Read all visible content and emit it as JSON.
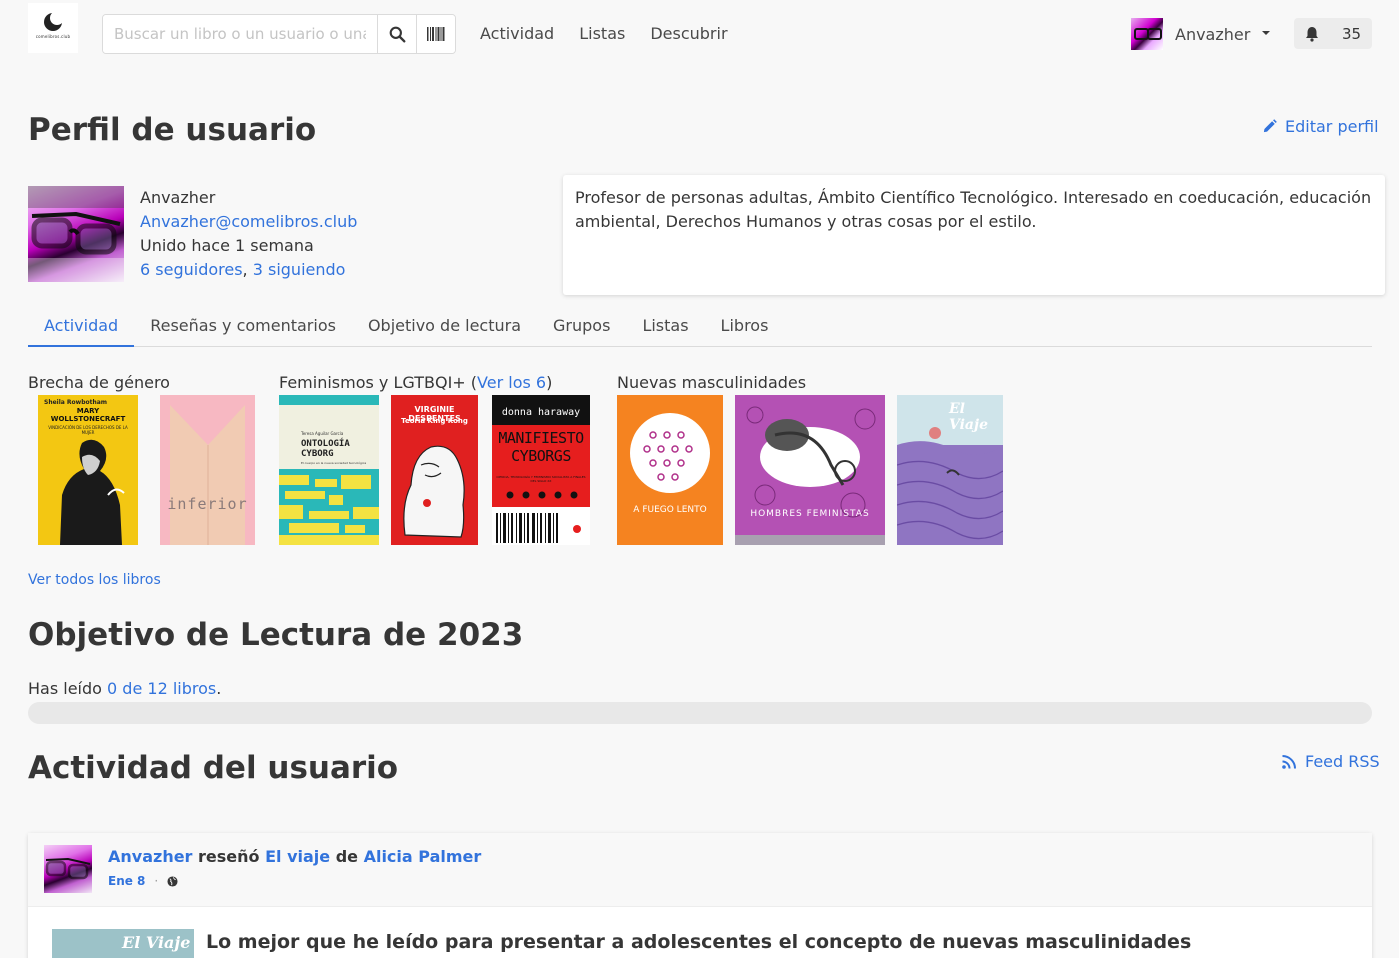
{
  "nav": {
    "logo_text": "comelibros.club",
    "search_placeholder": "Buscar un libro o un usuario o una lista",
    "links": [
      "Actividad",
      "Listas",
      "Descubrir"
    ],
    "username": "Anvazher",
    "notifications_count": "35"
  },
  "profile": {
    "title": "Perfil de usuario",
    "edit_label": "Editar perfil",
    "display_name": "Anvazher",
    "handle": "Anvazher@comelibros.club",
    "joined": "Unido hace 1 semana",
    "followers": "6 seguidores",
    "following": "3 siguiendo",
    "bio": "Profesor de personas adultas, Ámbito Científico Tecnológico. Interesado en coeducación, educación ambiental, Derechos Humanos y otras cosas por el estilo."
  },
  "tabs": [
    {
      "label": "Actividad",
      "active": true
    },
    {
      "label": "Reseñas y comentarios",
      "active": false
    },
    {
      "label": "Objetivo de lectura",
      "active": false
    },
    {
      "label": "Grupos",
      "active": false
    },
    {
      "label": "Listas",
      "active": false
    },
    {
      "label": "Libros",
      "active": false
    }
  ],
  "shelves": [
    {
      "title": "Brecha de género",
      "books": [
        {
          "top": "Sheila Rowbotham",
          "title": "MARY WOLLSTONECRAFT",
          "subtitle": "VINDICACIÓN DE LOS DERECHOS DE LA MUJER",
          "color": "#f1c40f"
        },
        {
          "title": "inferior",
          "color": "#f6b4c0"
        }
      ]
    },
    {
      "title": "Feminismos y LGTBQI+",
      "see_more": "Ver los 6",
      "books": [
        {
          "top": "Teresa Aguilar García",
          "title": "ONTOLOGÍA CYBORG",
          "subtitle": "El cuerpo en la nueva sociedad tecnológica",
          "color": "#f4e242"
        },
        {
          "top": "VIRGINIE DESPENTES",
          "title": "Teoría King Kong",
          "color": "#e02020"
        },
        {
          "top": "donna haraway",
          "title": "MANIFIESTO CYBORGS",
          "subtitle": "CIENCIA, TECNOLOGÍA Y FEMINISMO SOCIALISTA A FINALES DEL SIGLO XX",
          "color": "#e61e1e"
        }
      ]
    },
    {
      "title": "Nuevas masculinidades",
      "books": [
        {
          "title": "A FUEGO LENTO",
          "color": "#f58320"
        },
        {
          "title": "HOMBRES FEMINISTAS",
          "color": "#b451b4"
        },
        {
          "title": "El Viaje",
          "color": "#8f75c2"
        }
      ]
    }
  ],
  "see_all_books": "Ver todos los libros",
  "goal": {
    "title": "Objetivo de Lectura de 2023",
    "text_prefix": "Has leído ",
    "link": "0 de 12 libros",
    "text_suffix": ".",
    "progress": 0
  },
  "activity": {
    "title": "Actividad del usuario",
    "rss_label": "Feed RSS",
    "item": {
      "user": "Anvazher",
      "verb": " reseñó ",
      "book": "El viaje",
      "by": " de ",
      "author": "Alicia Palmer",
      "date": "Ene 8",
      "separator": "·",
      "review_title": "Lo mejor que he leído para presentar a adolescentes el concepto de nuevas masculinidades",
      "cover_title": "El Viaje"
    }
  }
}
